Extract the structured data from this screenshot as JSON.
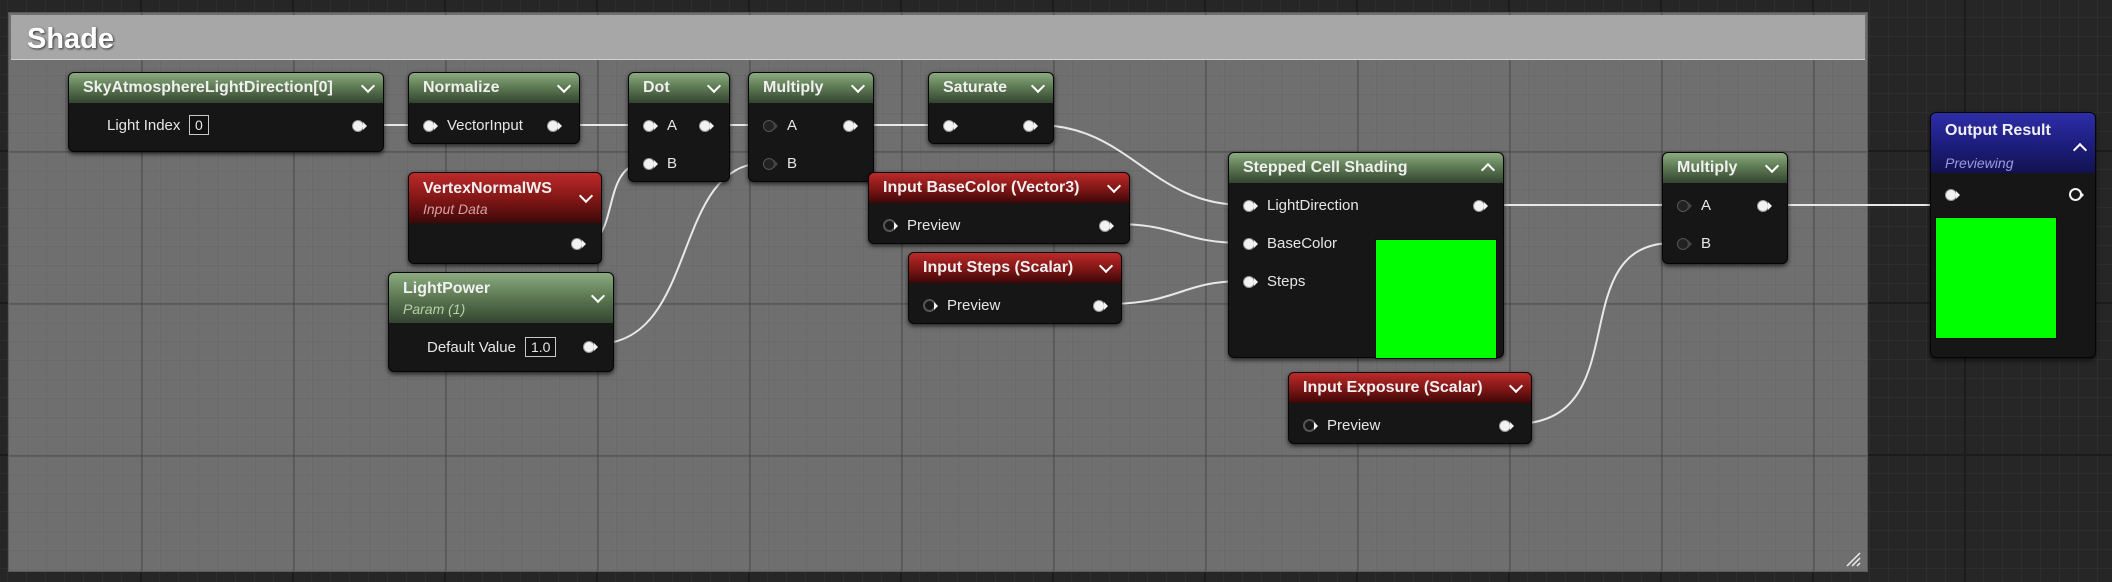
{
  "comment": {
    "title": "Shade"
  },
  "colors": {
    "preview": "#00ff00",
    "wire": "#e8e8e8"
  },
  "nodes": {
    "sky_light": {
      "title": "SkyAtmosphereLightDirection[0]",
      "light_index_label": "Light Index",
      "light_index_value": "0"
    },
    "normalize": {
      "title": "Normalize",
      "input_label": "VectorInput"
    },
    "dot": {
      "title": "Dot",
      "a": "A",
      "b": "B"
    },
    "multiply1": {
      "title": "Multiply",
      "a": "A",
      "b": "B"
    },
    "saturate": {
      "title": "Saturate"
    },
    "vertex_normal": {
      "title": "VertexNormalWS",
      "subtitle": "Input Data"
    },
    "light_power": {
      "title": "LightPower",
      "subtitle": "Param (1)",
      "default_label": "Default Value",
      "default_value": "1.0"
    },
    "base_color": {
      "title": "Input BaseColor (Vector3)",
      "preview_label": "Preview"
    },
    "steps": {
      "title": "Input Steps (Scalar)",
      "preview_label": "Preview"
    },
    "stepped": {
      "title": "Stepped Cell Shading",
      "light_direction": "LightDirection",
      "base_color": "BaseColor",
      "steps": "Steps"
    },
    "exposure": {
      "title": "Input Exposure (Scalar)",
      "preview_label": "Preview"
    },
    "multiply2": {
      "title": "Multiply",
      "a": "A",
      "b": "B"
    },
    "output": {
      "title": "Output Result",
      "subtitle": "Previewing"
    }
  }
}
